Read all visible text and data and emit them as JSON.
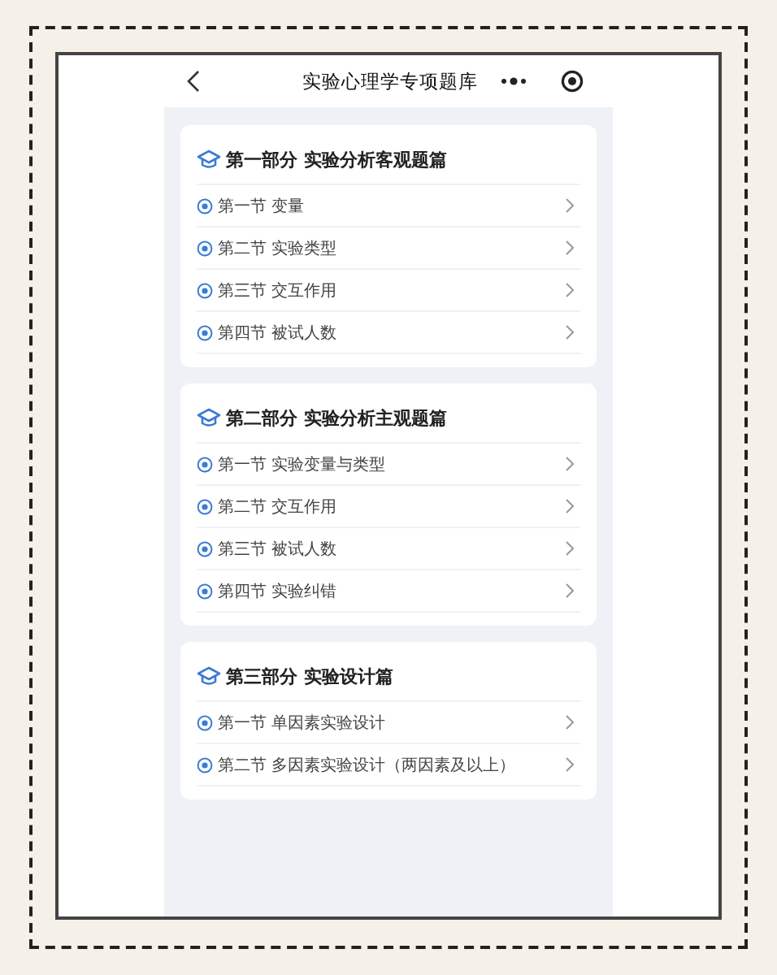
{
  "nav": {
    "title": "实验心理学专项题库"
  },
  "sections": [
    {
      "title": "第一部分 实验分析客观题篇",
      "items": [
        {
          "label": "第一节 变量"
        },
        {
          "label": "第二节 实验类型"
        },
        {
          "label": "第三节 交互作用"
        },
        {
          "label": "第四节 被试人数"
        }
      ]
    },
    {
      "title": "第二部分 实验分析主观题篇",
      "items": [
        {
          "label": "第一节 实验变量与类型"
        },
        {
          "label": "第二节 交互作用"
        },
        {
          "label": "第三节 被试人数"
        },
        {
          "label": "第四节 实验纠错"
        }
      ]
    },
    {
      "title": "第三部分 实验设计篇",
      "items": [
        {
          "label": "第一节 单因素实验设计"
        },
        {
          "label": "第二节 多因素实验设计（两因素及以上）"
        }
      ]
    }
  ]
}
